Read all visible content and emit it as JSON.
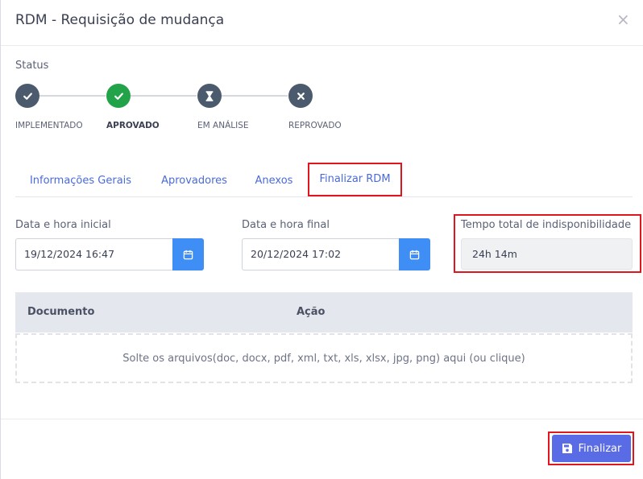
{
  "header": {
    "title": "RDM - Requisição de mudança",
    "close_glyph": "×"
  },
  "status": {
    "label": "Status",
    "steps": [
      {
        "label": "IMPLEMENTADO",
        "color": "#4b5a6c",
        "icon": "check-icon",
        "active": false
      },
      {
        "label": "APROVADO",
        "color": "#22a34a",
        "icon": "check-icon",
        "active": true
      },
      {
        "label": "EM ANÁLISE",
        "color": "#4b5a6c",
        "icon": "hourglass-icon",
        "active": false
      },
      {
        "label": "REPROVADO",
        "color": "#4b5a6c",
        "icon": "close-icon",
        "active": false
      }
    ]
  },
  "tabs": [
    {
      "label": "Informações Gerais",
      "active": false
    },
    {
      "label": "Aprovadores",
      "active": false
    },
    {
      "label": "Anexos",
      "active": false
    },
    {
      "label": "Finalizar RDM",
      "active": true
    }
  ],
  "form": {
    "start": {
      "label": "Data e hora inicial",
      "value": "19/12/2024 16:47"
    },
    "end": {
      "label": "Data e hora final",
      "value": "20/12/2024 17:02"
    },
    "total": {
      "label": "Tempo total de indisponibilidade",
      "value": "24h 14m"
    }
  },
  "documents": {
    "columns": [
      "Documento",
      "Ação"
    ],
    "dropzone_text": "Solte os arquivos(doc, docx, pdf, xml, txt, xls, xlsx, jpg, png) aqui (ou clique)"
  },
  "footer": {
    "finalize_label": "Finalizar"
  },
  "colors": {
    "accent": "#5a6be6",
    "calendar_button": "#3f8ef5",
    "approved": "#22a34a",
    "highlight": "#e0161f",
    "link": "#4a6bd6"
  }
}
